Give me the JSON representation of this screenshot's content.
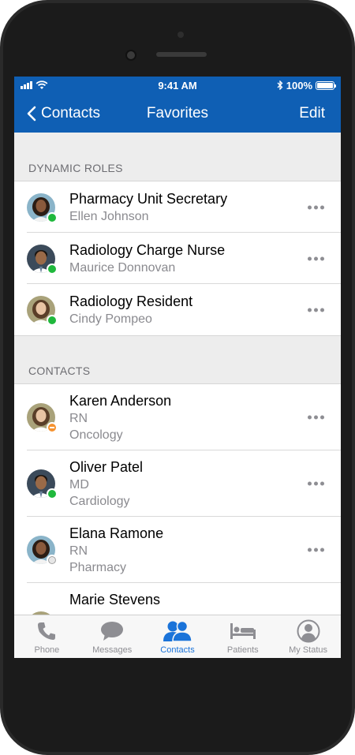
{
  "status_bar": {
    "time": "9:41 AM",
    "battery": "100%",
    "battery_level": 1.0
  },
  "nav": {
    "back_label": "Contacts",
    "title": "Favorites",
    "edit_label": "Edit"
  },
  "sections": {
    "dynamic_roles": {
      "header": "DYNAMIC ROLES",
      "items": [
        {
          "title": "Pharmacy Unit Secretary",
          "subtitle": "Ellen Johnson",
          "status": "available",
          "avatar": "female-dark-hair"
        },
        {
          "title": "Radiology Charge Nurse",
          "subtitle": "Maurice Donnovan",
          "status": "available",
          "avatar": "male-dark-hair"
        },
        {
          "title": "Radiology Resident",
          "subtitle": "Cindy Pompeo",
          "status": "available",
          "avatar": "female-brown-hair"
        }
      ]
    },
    "contacts": {
      "header": "CONTACTS",
      "items": [
        {
          "name": "Karen Anderson",
          "role": "RN",
          "department": "Oncology",
          "status": "away"
        },
        {
          "name": "Oliver Patel",
          "role": "MD",
          "department": "Cardiology",
          "status": "available"
        },
        {
          "name": "Elana Ramone",
          "role": "RN",
          "department": "Pharmacy",
          "status": "offline"
        },
        {
          "name": "Marie Stevens"
        }
      ]
    }
  },
  "status_colors": {
    "available": "#1fb83c",
    "away": "#f5922f",
    "offline": "#cfcfcf"
  },
  "tabs": [
    {
      "label": "Phone",
      "icon": "phone-icon",
      "active": false
    },
    {
      "label": "Messages",
      "icon": "chat-bubble-icon",
      "active": false
    },
    {
      "label": "Contacts",
      "icon": "people-icon",
      "active": true
    },
    {
      "label": "Patients",
      "icon": "bed-icon",
      "active": false
    },
    {
      "label": "My Status",
      "icon": "user-circle-icon",
      "active": false
    }
  ],
  "colors": {
    "brand_blue": "#0f5fb4",
    "active_tab": "#1a73d9",
    "inactive_tab": "#8e8e93"
  }
}
